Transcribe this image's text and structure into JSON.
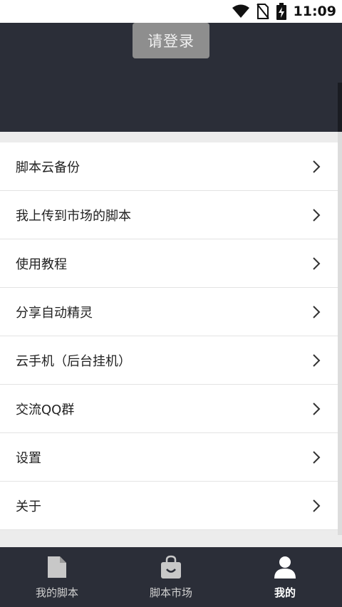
{
  "status_bar": {
    "time": "11:09",
    "icons": [
      "wifi-icon",
      "no-sim-icon",
      "battery-charging-icon"
    ]
  },
  "header": {
    "login_label": "请登录"
  },
  "menu": {
    "items": [
      {
        "label": "脚本云备份"
      },
      {
        "label": "我上传到市场的脚本"
      },
      {
        "label": "使用教程"
      },
      {
        "label": "分享自动精灵"
      },
      {
        "label": "云手机（后台挂机）"
      },
      {
        "label": "交流QQ群"
      },
      {
        "label": "设置"
      },
      {
        "label": "关于"
      }
    ]
  },
  "bottom_nav": {
    "items": [
      {
        "label": "我的脚本",
        "icon": "document-icon",
        "active": false
      },
      {
        "label": "脚本市场",
        "icon": "shopping-bag-icon",
        "active": false
      },
      {
        "label": "我的",
        "icon": "person-icon",
        "active": true
      }
    ]
  }
}
